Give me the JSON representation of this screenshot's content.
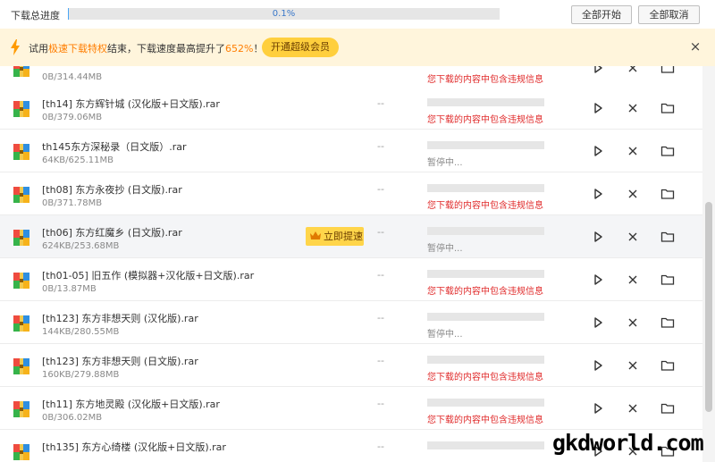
{
  "header": {
    "total_label": "下载总进度",
    "progress": 0.001,
    "progress_text": "0.1%",
    "start_all_label": "全部开始",
    "cancel_all_label": "全部取消"
  },
  "banner": {
    "text_prefix": "试用",
    "text_highlight": "极速下载特权",
    "text_middle": "结束，下载速度最高提升了",
    "text_percent": "652%",
    "text_suffix": "！",
    "vip_button_label": "开通超级会员",
    "close_glyph": "×"
  },
  "boost_label": "立即提速",
  "colors": {
    "accent": "#4ba6f6",
    "error": "#e02b2b",
    "highlight": "#ff7d00",
    "vip": "#ffcf3d"
  },
  "rows": [
    {
      "name": "",
      "size": "0B/314.44MB",
      "speed": "",
      "status": "您下载的内容中包含违规信息",
      "status_type": "err",
      "partial": true
    },
    {
      "name": "[th14] 东方辉针城 (汉化版+日文版).rar",
      "size": "0B/379.06MB",
      "speed": "--",
      "status": "您下载的内容中包含违规信息",
      "status_type": "err"
    },
    {
      "name": "th145东方深秘录（日文版）.rar",
      "size": "64KB/625.11MB",
      "speed": "--",
      "status": "暂停中...",
      "status_type": "pause"
    },
    {
      "name": "[th08] 东方永夜抄 (日文版).rar",
      "size": "0B/371.78MB",
      "speed": "--",
      "status": "您下载的内容中包含违规信息",
      "status_type": "err"
    },
    {
      "name": "[th06] 东方红魔乡 (日文版).rar",
      "size": "624KB/253.68MB",
      "speed": "--",
      "status": "暂停中...",
      "status_type": "pause",
      "hover": true
    },
    {
      "name": "[th01-05] 旧五作 (模拟器+汉化版+日文版).rar",
      "size": "0B/13.87MB",
      "speed": "--",
      "status": "您下载的内容中包含违规信息",
      "status_type": "err"
    },
    {
      "name": "[th123] 东方非想天则 (汉化版).rar",
      "size": "144KB/280.55MB",
      "speed": "--",
      "status": "暂停中...",
      "status_type": "pause"
    },
    {
      "name": "[th123] 东方非想天则 (日文版).rar",
      "size": "160KB/279.88MB",
      "speed": "--",
      "status": "您下载的内容中包含违规信息",
      "status_type": "err"
    },
    {
      "name": "[th11] 东方地灵殿 (汉化版+日文版).rar",
      "size": "0B/306.02MB",
      "speed": "--",
      "status": "您下载的内容中包含违规信息",
      "status_type": "err"
    },
    {
      "name": "[th135] 东方心绮楼 (汉化版+日文版).rar",
      "size": "",
      "speed": "--",
      "status": "",
      "status_type": "pause"
    }
  ],
  "watermark": "gkdworld.com"
}
